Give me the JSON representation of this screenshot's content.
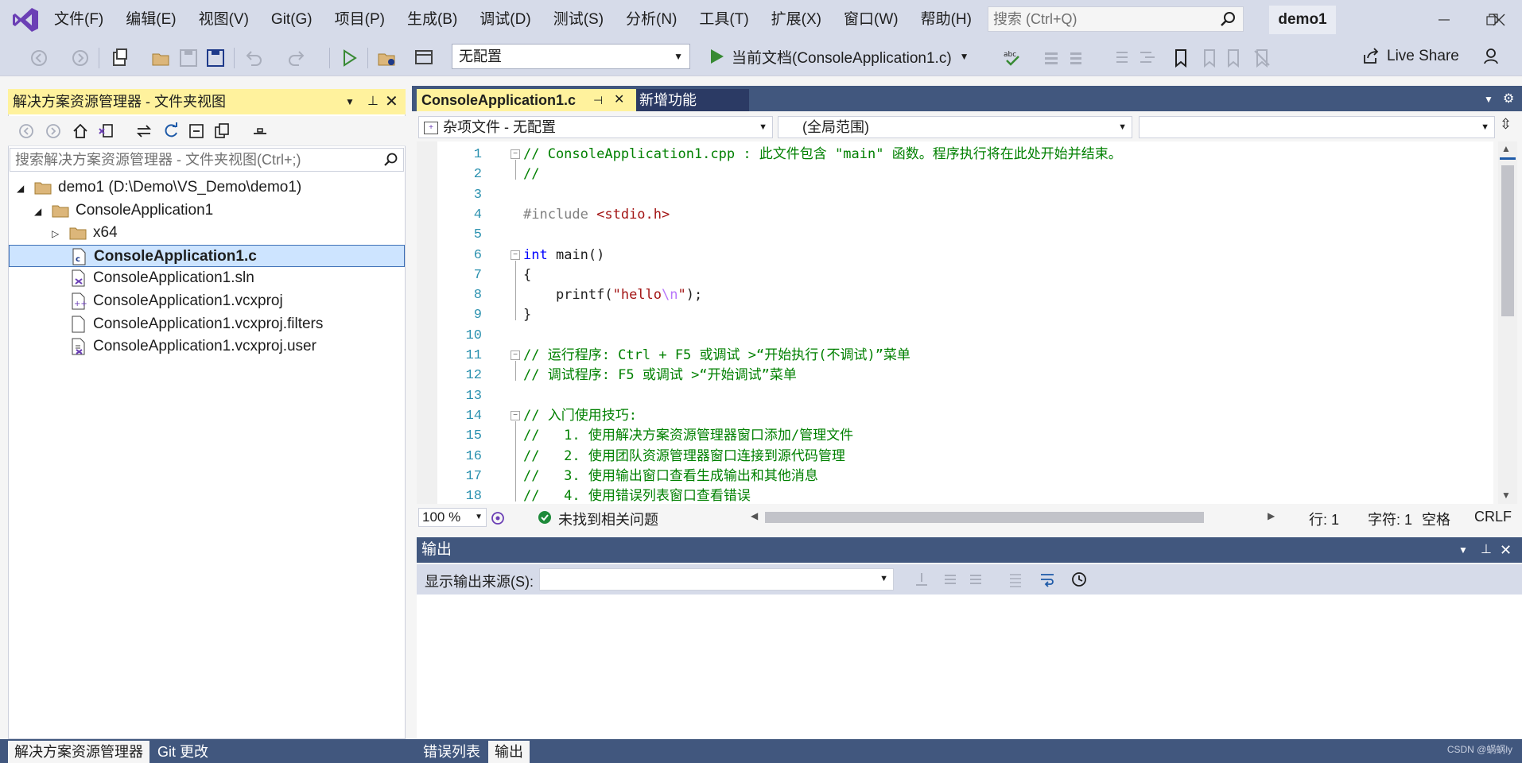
{
  "menu": {
    "items": [
      "文件(F)",
      "编辑(E)",
      "视图(V)",
      "Git(G)",
      "项目(P)",
      "生成(B)",
      "调试(D)",
      "测试(S)",
      "分析(N)",
      "工具(T)",
      "扩展(X)",
      "窗口(W)",
      "帮助(H)"
    ],
    "search_placeholder": "搜索 (Ctrl+Q)",
    "solution_name": "demo1"
  },
  "toolbar": {
    "config": "无配置",
    "run_label": "当前文档(ConsoleApplication1.c)",
    "live_share": "Live Share"
  },
  "solution_explorer": {
    "title": "解决方案资源管理器 - 文件夹视图",
    "search_placeholder": "搜索解决方案资源管理器 - 文件夹视图(Ctrl+;)",
    "tree": [
      {
        "label": "demo1 (D:\\Demo\\VS_Demo\\demo1)",
        "indent": 0,
        "expander": "open",
        "icon": "folder-icon"
      },
      {
        "label": "ConsoleApplication1",
        "indent": 1,
        "expander": "open",
        "icon": "folder-icon"
      },
      {
        "label": "x64",
        "indent": 2,
        "expander": "closed",
        "icon": "folder-icon"
      },
      {
        "label": "ConsoleApplication1.c",
        "indent": 2,
        "expander": "",
        "icon": "c-file-icon",
        "selected": true
      },
      {
        "label": "ConsoleApplication1.sln",
        "indent": 2,
        "expander": "",
        "icon": "sln-file-icon"
      },
      {
        "label": "ConsoleApplication1.vcxproj",
        "indent": 2,
        "expander": "",
        "icon": "vcxproj-file-icon"
      },
      {
        "label": "ConsoleApplication1.vcxproj.filters",
        "indent": 2,
        "expander": "",
        "icon": "file-icon"
      },
      {
        "label": "ConsoleApplication1.vcxproj.user",
        "indent": 2,
        "expander": "",
        "icon": "user-file-icon"
      }
    ]
  },
  "editor": {
    "tabs": [
      {
        "label": "ConsoleApplication1.c",
        "active": true
      },
      {
        "label": "新增功能",
        "active": false
      }
    ],
    "nav_project": "杂项文件 - 无配置",
    "nav_scope": "(全局范围)",
    "nav_member": "",
    "lines": [
      {
        "n": "1",
        "parts": [
          {
            "t": "// ConsoleApplication1.cpp : 此文件包含 \"main\" 函数。程序执行将在此处开始并结束。",
            "c": "cmt"
          }
        ]
      },
      {
        "n": "2",
        "parts": [
          {
            "t": "//",
            "c": "cmt"
          }
        ]
      },
      {
        "n": "3",
        "parts": []
      },
      {
        "n": "4",
        "parts": [
          {
            "t": "#include ",
            "c": "pp"
          },
          {
            "t": "<stdio.h>",
            "c": "str"
          }
        ]
      },
      {
        "n": "5",
        "parts": []
      },
      {
        "n": "6",
        "parts": [
          {
            "t": "int",
            "c": "kw"
          },
          {
            "t": " main()",
            "c": ""
          }
        ]
      },
      {
        "n": "7",
        "parts": [
          {
            "t": "{",
            "c": ""
          }
        ]
      },
      {
        "n": "8",
        "parts": [
          {
            "t": "    printf(",
            "c": ""
          },
          {
            "t": "\"hello",
            "c": "str"
          },
          {
            "t": "\\n",
            "c": "esc"
          },
          {
            "t": "\"",
            "c": "str"
          },
          {
            "t": ");",
            "c": ""
          }
        ]
      },
      {
        "n": "9",
        "parts": [
          {
            "t": "}",
            "c": ""
          }
        ]
      },
      {
        "n": "10",
        "parts": []
      },
      {
        "n": "11",
        "parts": [
          {
            "t": "// 运行程序: Ctrl + F5 或调试 >“开始执行(不调试)”菜单",
            "c": "cmt"
          }
        ]
      },
      {
        "n": "12",
        "parts": [
          {
            "t": "// 调试程序: F5 或调试 >“开始调试”菜单",
            "c": "cmt"
          }
        ]
      },
      {
        "n": "13",
        "parts": []
      },
      {
        "n": "14",
        "parts": [
          {
            "t": "// 入门使用技巧:",
            "c": "cmt"
          }
        ]
      },
      {
        "n": "15",
        "parts": [
          {
            "t": "//   1. 使用解决方案资源管理器窗口添加/管理文件",
            "c": "cmt"
          }
        ]
      },
      {
        "n": "16",
        "parts": [
          {
            "t": "//   2. 使用团队资源管理器窗口连接到源代码管理",
            "c": "cmt"
          }
        ]
      },
      {
        "n": "17",
        "parts": [
          {
            "t": "//   3. 使用输出窗口查看生成输出和其他消息",
            "c": "cmt"
          }
        ]
      },
      {
        "n": "18",
        "parts": [
          {
            "t": "//   4. 使用错误列表窗口查看错误",
            "c": "cmt"
          }
        ]
      }
    ],
    "zoom": "100 %",
    "issues": "未找到相关问题",
    "status_line": "行: 1",
    "status_col": "字符: 1",
    "status_ws": "空格",
    "status_eol": "CRLF"
  },
  "output": {
    "title": "输出",
    "source_label": "显示输出来源(S):",
    "source_value": ""
  },
  "bottom_tabs": {
    "left": [
      "解决方案资源管理器",
      "Git 更改"
    ],
    "right": [
      "错误列表",
      "输出"
    ]
  },
  "watermark": "CSDN @蜗蜗ly",
  "colors": {
    "accent_yellow": "#fff29d",
    "panel_blue": "#41577e",
    "chrome": "#d6dbe9"
  }
}
